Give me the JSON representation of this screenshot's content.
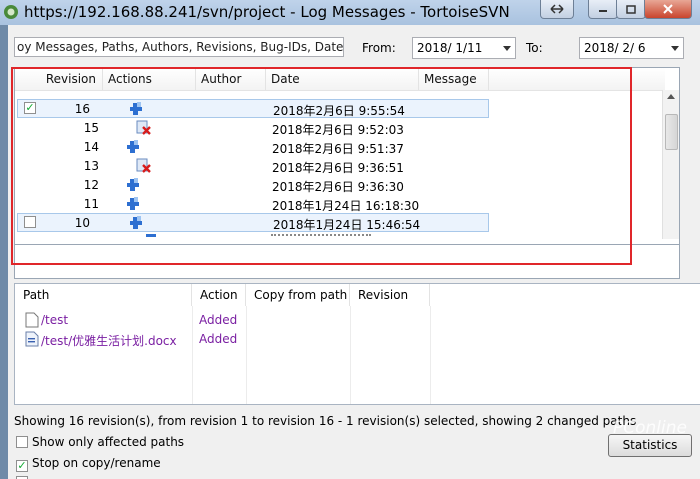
{
  "window": {
    "title": "https://192.168.88.241/svn/project - Log Messages - TortoiseSVN"
  },
  "filter": {
    "placeholder": "oy Messages, Paths, Authors, Revisions, Bug-IDs, Date, Date",
    "from_label": "From:",
    "from_value": "2018/  1/11",
    "to_label": "To:",
    "to_value": "2018/  2/  6"
  },
  "log_table": {
    "columns": [
      "Revision",
      "Actions",
      "Author",
      "Date",
      "Message"
    ],
    "rows": [
      {
        "revision": "16",
        "action_icon": "modify-icon",
        "author": "",
        "date": "2018年2月6日 9:55:54",
        "message": "",
        "checkbox": "checked",
        "selected": true
      },
      {
        "revision": "15",
        "action_icon": "delete-icon",
        "author": "",
        "date": "2018年2月6日 9:52:03",
        "message": "",
        "checkbox": "none",
        "selected": false
      },
      {
        "revision": "14",
        "action_icon": "modify-icon",
        "author": "",
        "date": "2018年2月6日 9:51:37",
        "message": "",
        "checkbox": "none",
        "selected": false
      },
      {
        "revision": "13",
        "action_icon": "delete-icon",
        "author": "",
        "date": "2018年2月6日 9:36:51",
        "message": "",
        "checkbox": "none",
        "selected": false
      },
      {
        "revision": "12",
        "action_icon": "modify-icon",
        "author": "",
        "date": "2018年2月6日 9:36:30",
        "message": "",
        "checkbox": "none",
        "selected": false
      },
      {
        "revision": "11",
        "action_icon": "modify-icon",
        "author": "",
        "date": "2018年1月24日 16:18:30",
        "message": "",
        "checkbox": "none",
        "selected": false
      },
      {
        "revision": "10",
        "action_icon": "modify-icon",
        "author": "",
        "date": "2018年1月24日 15:46:54",
        "message": "",
        "checkbox": "unchecked",
        "selected": true
      }
    ]
  },
  "paths_table": {
    "columns": [
      "Path",
      "Action",
      "Copy from path",
      "Revision"
    ],
    "rows": [
      {
        "path": "/test",
        "action": "Added",
        "copy_from": "",
        "revision": "",
        "icon": "folder-file-icon"
      },
      {
        "path": "/test/优雅生活计划.docx",
        "action": "Added",
        "copy_from": "",
        "revision": "",
        "icon": "word-document-icon"
      }
    ]
  },
  "status": {
    "text": "Showing 16 revision(s), from revision 1 to revision 16 - 1 revision(s) selected, showing 2 changed paths"
  },
  "options": {
    "show_only_affected": "Show only affected paths",
    "stop_on_copy": "Stop on copy/rename",
    "show_only_affected_checked": false,
    "stop_on_copy_checked": true
  },
  "buttons": {
    "statistics": "Statistics"
  },
  "watermark": "PConline",
  "colors": {
    "highlight_border": "#e0262a",
    "selected_row": "#ebf3fd",
    "path_text": "#7a1fa2"
  }
}
